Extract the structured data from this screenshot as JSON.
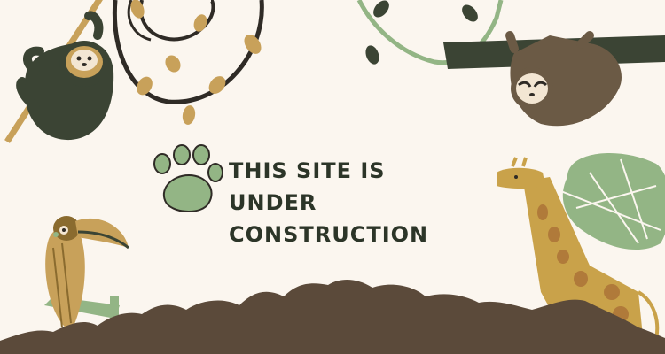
{
  "headline": {
    "line1": "THIS SITE IS UNDER",
    "line2": "CONSTRUCTION"
  },
  "colors": {
    "background": "#fbf6ef",
    "text": "#2c3528",
    "sage": "#93b585",
    "dark_green": "#3b4434",
    "brown": "#5a4a3a",
    "giraffe": "#c9a24a",
    "giraffe_spot": "#b07a3a",
    "soil": "#5b4a3a",
    "vine": "#2f2b26",
    "leaf_gold": "#c8a15a",
    "sloth_brown": "#6b5a45"
  },
  "decorations": [
    "sloth-left-icon",
    "hanging-vines-icon",
    "sloth-right-icon",
    "paw-print-icon",
    "toucan-icon",
    "giraffe-icon",
    "monstera-leaf-icon",
    "soil-ground-icon"
  ]
}
